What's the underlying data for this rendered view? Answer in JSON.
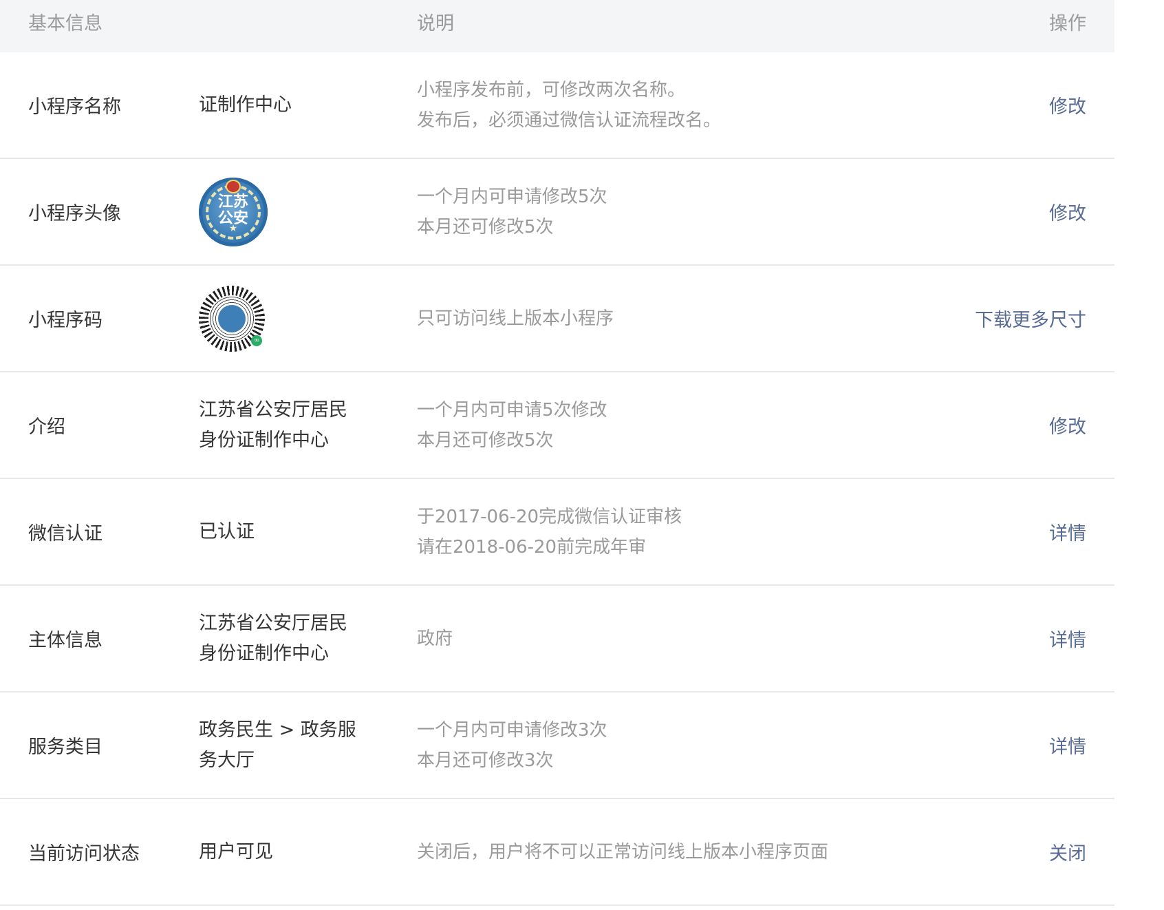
{
  "header": {
    "col_info": "基本信息",
    "col_desc": "说明",
    "col_op": "操作"
  },
  "rows": [
    {
      "label": "小程序名称",
      "value_lines": [
        "证制作中心"
      ],
      "desc_lines": [
        "小程序发布前，可修改两次名称。",
        "发布后，必须通过微信认证流程改名。"
      ],
      "action": "修改"
    },
    {
      "label": "小程序头像",
      "value_image": "avatar-icon",
      "avatar_text": [
        "江苏",
        "公安"
      ],
      "desc_lines": [
        "一个月内可申请修改5次",
        "本月还可修改5次"
      ],
      "action": "修改"
    },
    {
      "label": "小程序码",
      "value_image": "qrcode-icon",
      "desc_lines": [
        "只可访问线上版本小程序"
      ],
      "action": "下载更多尺寸"
    },
    {
      "label": "介绍",
      "value_lines": [
        "江苏省公安厅居民",
        "身份证制作中心"
      ],
      "desc_lines": [
        "一个月内可申请5次修改",
        "本月还可修改5次"
      ],
      "action": "修改"
    },
    {
      "label": "微信认证",
      "value_lines": [
        "已认证"
      ],
      "desc_lines": [
        "于2017-06-20完成微信认证审核",
        "请在2018-06-20前完成年审"
      ],
      "action": "详情"
    },
    {
      "label": "主体信息",
      "value_lines": [
        "江苏省公安厅居民",
        "身份证制作中心"
      ],
      "desc_lines": [
        "政府"
      ],
      "action": "详情"
    },
    {
      "label": "服务类目",
      "value_lines": [
        "政务民生 > 政务服",
        "务大厅"
      ],
      "desc_lines": [
        "一个月内可申请修改3次",
        "本月还可修改3次"
      ],
      "action": "详情"
    },
    {
      "label": "当前访问状态",
      "value_lines": [
        "用户可见"
      ],
      "desc_lines": [
        "关闭后，用户将不可以正常访问线上版本小程序页面"
      ],
      "action": "关闭"
    }
  ],
  "colors": {
    "link": "#576b95",
    "text": "#353535",
    "muted": "#9a9a9a",
    "header_bg": "#f4f5f7"
  }
}
